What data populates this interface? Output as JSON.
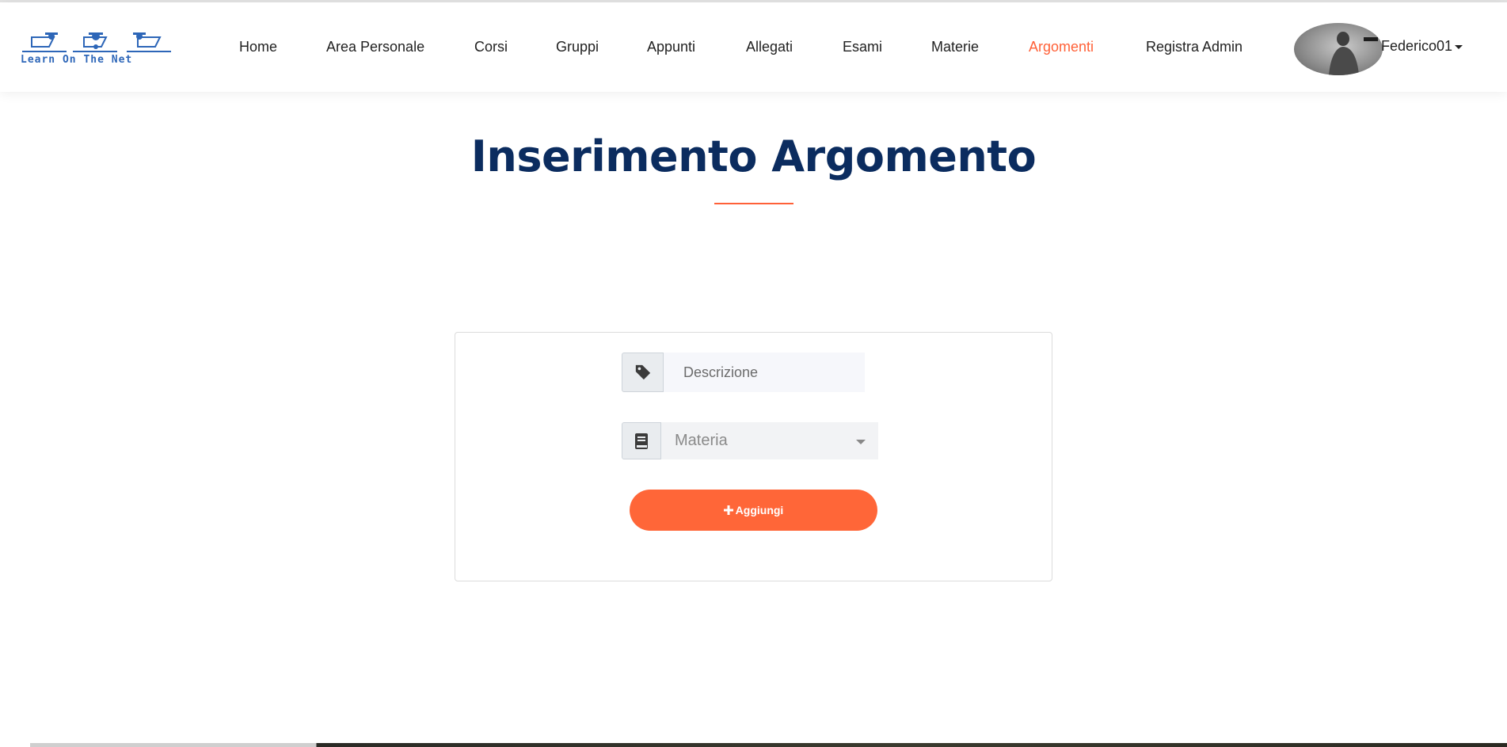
{
  "logo": {
    "text": "Learn On The Net"
  },
  "nav": {
    "items": [
      {
        "label": "Home",
        "active": false
      },
      {
        "label": "Area Personale",
        "active": false
      },
      {
        "label": "Corsi",
        "active": false
      },
      {
        "label": "Gruppi",
        "active": false
      },
      {
        "label": "Appunti",
        "active": false
      },
      {
        "label": "Allegati",
        "active": false
      },
      {
        "label": "Esami",
        "active": false
      },
      {
        "label": "Materie",
        "active": false
      },
      {
        "label": "Argomenti",
        "active": true
      },
      {
        "label": "Registra Admin",
        "active": false
      }
    ],
    "user": {
      "name": "Federico01"
    }
  },
  "page": {
    "title": "Inserimento Argomento"
  },
  "form": {
    "descrizione": {
      "placeholder": "Descrizione",
      "icon": "tag-icon"
    },
    "materia": {
      "selected": "Materia",
      "icon": "book-icon"
    },
    "submit": {
      "label": "Aggiungi",
      "icon": "plus-icon"
    }
  },
  "colors": {
    "accent": "#ff6138",
    "title": "#0b2c5f"
  }
}
